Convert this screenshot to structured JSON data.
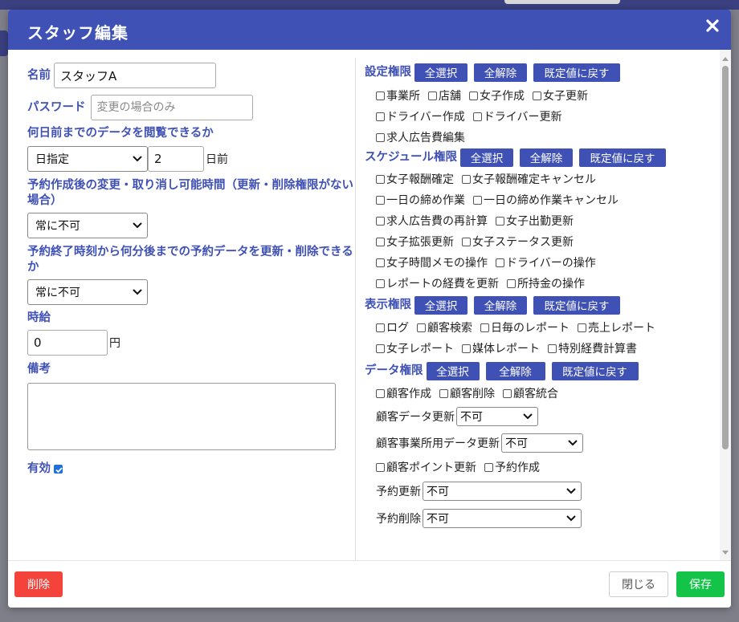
{
  "modal": {
    "title": "スタッフ編集",
    "close_icon": "close-icon"
  },
  "left": {
    "name_label": "名前",
    "name_value": "スタッフA",
    "password_label": "パスワード",
    "password_placeholder": "変更の場合のみ",
    "view_days_label": "何日前までのデータを閲覧できるか",
    "view_days_mode": "日指定",
    "view_days_value": "2",
    "view_days_suffix": "日前",
    "change_after_label": "予約作成後の変更・取り消し可能時間（更新・削除権限がない場合）",
    "change_after_value": "常に不可",
    "update_after_end_label": "予約終了時刻から何分後までの予約データを更新・削除できるか",
    "update_after_end_value": "常に不可",
    "hourly_label": "時給",
    "hourly_value": "0",
    "hourly_suffix": "円",
    "note_label": "備考",
    "note_value": "",
    "active_label": "有効",
    "active_checked": true
  },
  "right": {
    "buttons": {
      "select_all": "全選択",
      "clear_all": "全解除",
      "reset_default": "既定値に戻す"
    },
    "settings": {
      "label": "設定権限",
      "rows": [
        [
          "事業所",
          "店舗",
          "女子作成",
          "女子更新"
        ],
        [
          "ドライバー作成",
          "ドライバー更新"
        ],
        [
          "求人広告費編集"
        ]
      ]
    },
    "schedule": {
      "label": "スケジュール権限",
      "rows": [
        [
          "女子報酬確定",
          "女子報酬確定キャンセル"
        ],
        [
          "一日の締め作業",
          "一日の締め作業キャンセル"
        ],
        [
          "求人広告費の再計算",
          "女子出勤更新"
        ],
        [
          "女子拡張更新",
          "女子ステータス更新"
        ],
        [
          "女子時間メモの操作",
          "ドライバーの操作"
        ],
        [
          "レポートの経費を更新",
          "所持金の操作"
        ]
      ]
    },
    "display": {
      "label": "表示権限",
      "rows": [
        [
          "ログ",
          "顧客検索",
          "日毎のレポート",
          "売上レポート"
        ],
        [
          "女子レポート",
          "媒体レポート",
          "特別経費計算書"
        ]
      ]
    },
    "data": {
      "label": "データ権限",
      "row1": [
        "顧客作成",
        "顧客削除",
        "顧客統合"
      ],
      "customer_update_label": "顧客データ更新",
      "customer_update_value": "不可",
      "office_update_label": "顧客事業所用データ更新",
      "office_update_value": "不可",
      "row2": [
        "顧客ポイント更新",
        "予約作成"
      ],
      "reservation_update_label": "予約更新",
      "reservation_update_value": "不可",
      "reservation_delete_label": "予約削除",
      "reservation_delete_value": "不可"
    }
  },
  "footer": {
    "delete": "削除",
    "close": "閉じる",
    "save": "保存"
  },
  "colors": {
    "primary": "#3f51b5",
    "danger": "#f4433a",
    "success": "#14c448"
  }
}
